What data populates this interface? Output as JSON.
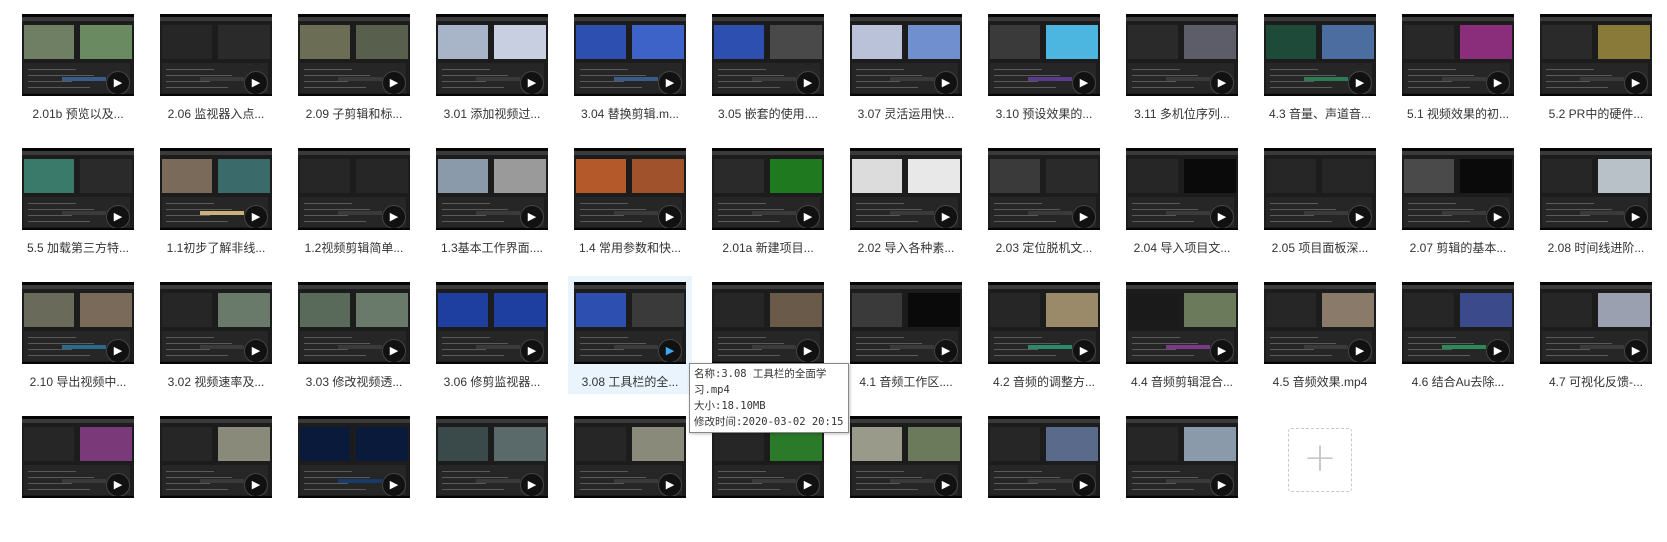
{
  "files": [
    {
      "name": "2.01b 预览以及...",
      "ps": [
        "#6e7f63",
        "#6a8b62"
      ],
      "tc": "#3a5a8a"
    },
    {
      "name": "2.06 监视器入点...",
      "ps": [
        "#262626",
        "#2a2a2a"
      ],
      "tc": "#3a3a3a"
    },
    {
      "name": "2.09 子剪辑和标...",
      "ps": [
        "#6b6d55",
        "#58604d"
      ],
      "tc": "#3a3a3a"
    },
    {
      "name": "3.01 添加视频过...",
      "ps": [
        "#a8b4c8",
        "#c7cfe0"
      ],
      "tc": "#3a3a3a"
    },
    {
      "name": "3.04 替换剪辑.m...",
      "ps": [
        "#2d4fb0",
        "#3d63c9"
      ],
      "tc": "#3a5a8a"
    },
    {
      "name": "3.05 嵌套的使用....",
      "ps": [
        "#2d4fb0",
        "#494949"
      ],
      "tc": "#3a3a3a"
    },
    {
      "name": "3.07 灵活运用快...",
      "ps": [
        "#b9c2d8",
        "#6f8fcf"
      ],
      "tc": "#3a3a3a"
    },
    {
      "name": "3.10 预设效果的...",
      "ps": [
        "#3a3a3a",
        "#4cb6e0"
      ],
      "tc": "#5a3a8a"
    },
    {
      "name": "3.11 多机位序列...",
      "ps": [
        "#2a2a2a",
        "#5d5d6a"
      ],
      "tc": "#3a3a3a"
    },
    {
      "name": "4.3 音量、声道音...",
      "ps": [
        "#1e4a3a",
        "#4c6da0"
      ],
      "tc": "#2e7a55"
    },
    {
      "name": "5.1 视频效果的初...",
      "ps": [
        "#282828",
        "#8a2d7a"
      ],
      "tc": "#3a3a3a"
    },
    {
      "name": "5.2 PR中的硬件...",
      "ps": [
        "#2a2a2a",
        "#8a7a3a"
      ],
      "tc": "#3a3a3a"
    },
    {
      "name": "5.5 加载第三方特...",
      "ps": [
        "#3a7a6a",
        "#2a2a2a"
      ],
      "tc": "#3a3a3a"
    },
    {
      "name": "1.1初步了解非线...",
      "ps": [
        "#7a6a5a",
        "#3a6a6a"
      ],
      "tc": "#c9b37a"
    },
    {
      "name": "1.2视频剪辑简单...",
      "ps": [
        "#262626",
        "#262626"
      ],
      "tc": "#3a3a3a"
    },
    {
      "name": "1.3基本工作界面....",
      "ps": [
        "#8a9aaa",
        "#9a9a9a"
      ],
      "tc": "#3a3a3a"
    },
    {
      "name": "1.4 常用参数和快...",
      "ps": [
        "#b45a2a",
        "#a0522d"
      ],
      "tc": "#3a3a3a"
    },
    {
      "name": "2.01a 新建项目...",
      "ps": [
        "#2a2a2a",
        "#1f7a1f"
      ],
      "tc": "#3a3a3a"
    },
    {
      "name": "2.02 导入各种素...",
      "ps": [
        "#dcdcdc",
        "#e8e8e8"
      ],
      "tc": "#3a3a3a"
    },
    {
      "name": "2.03 定位脱机文...",
      "ps": [
        "#3a3a3a",
        "#2a2a2a"
      ],
      "tc": "#3a3a3a"
    },
    {
      "name": "2.04 导入项目文...",
      "ps": [
        "#262626",
        "#0a0a0a"
      ],
      "tc": "#3a3a3a"
    },
    {
      "name": "2.05 项目面板深...",
      "ps": [
        "#262626",
        "#262626"
      ],
      "tc": "#3a3a3a"
    },
    {
      "name": "2.07 剪辑的基本...",
      "ps": [
        "#4a4a4a",
        "#0a0a0a"
      ],
      "tc": "#3a3a3a"
    },
    {
      "name": "2.08 时间线进阶...",
      "ps": [
        "#262626",
        "#b8c0c8"
      ],
      "tc": "#3a3a3a"
    },
    {
      "name": "2.10 导出视频中...",
      "ps": [
        "#6a6a5a",
        "#7a6a5a"
      ],
      "tc": "#2a6a8a"
    },
    {
      "name": "3.02 视频速率及...",
      "ps": [
        "#262626",
        "#6a7a6a"
      ],
      "tc": "#3a3a3a"
    },
    {
      "name": "3.03 修改视频透...",
      "ps": [
        "#5a6a5a",
        "#6a7a6a"
      ],
      "tc": "#3a3a3a"
    },
    {
      "name": "3.06 修剪监视器...",
      "ps": [
        "#1f3fa0",
        "#1f3fa0"
      ],
      "tc": "#3a3a3a"
    },
    {
      "name": "3.08 工具栏的全...",
      "ps": [
        "#2d4fb0",
        "#3a3a3a"
      ],
      "tc": "#3a3a3a"
    },
    {
      "name": "",
      "ps": [
        "#262626",
        "#6a5a4a"
      ],
      "tc": "#3a3a3a"
    },
    {
      "name": "4.1 音频工作区....",
      "ps": [
        "#3a3a3a",
        "#0a0a0a"
      ],
      "tc": "#3a3a3a"
    },
    {
      "name": "4.2 音频的调整方...",
      "ps": [
        "#262626",
        "#9a8a6a"
      ],
      "tc": "#2a8a6a"
    },
    {
      "name": "4.4 音频剪辑混合...",
      "ps": [
        "#1a1a1a",
        "#6a7a5a"
      ],
      "tc": "#7a3a8a"
    },
    {
      "name": "4.5 音频效果.mp4",
      "ps": [
        "#262626",
        "#8a7a6a"
      ],
      "tc": "#3a3a3a"
    },
    {
      "name": "4.6 结合Au去除...",
      "ps": [
        "#262626",
        "#3a4a8a"
      ],
      "tc": "#2a8a5a"
    },
    {
      "name": "4.7 可视化反馈-...",
      "ps": [
        "#262626",
        "#9aa0b0"
      ],
      "tc": "#3a3a3a"
    },
    {
      "name": "",
      "ps": [
        "#262626",
        "#7a3a7a"
      ],
      "tc": "#3a3a3a"
    },
    {
      "name": "",
      "ps": [
        "#262626",
        "#8a8a7a"
      ],
      "tc": "#3a3a3a"
    },
    {
      "name": "",
      "ps": [
        "#0a1a3a",
        "#0a1a3a"
      ],
      "tc": "#1a3a6a"
    },
    {
      "name": "",
      "ps": [
        "#3a4a4a",
        "#5a6a6a"
      ],
      "tc": "#3a3a3a"
    },
    {
      "name": "",
      "ps": [
        "#262626",
        "#8a8a7a"
      ],
      "tc": "#3a3a3a"
    },
    {
      "name": "",
      "ps": [
        "#262626",
        "#2a7a2a"
      ],
      "tc": "#3a3a3a"
    },
    {
      "name": "",
      "ps": [
        "#9a9a8a",
        "#6a7a5a"
      ],
      "tc": "#3a3a3a"
    },
    {
      "name": "",
      "ps": [
        "#262626",
        "#5a6a8a"
      ],
      "tc": "#3a3a3a"
    },
    {
      "name": "",
      "ps": [
        "#262626",
        "#8a9aaa"
      ],
      "tc": "#3a3a3a"
    }
  ],
  "selected_index": 28,
  "add_button": {
    "label": "+"
  },
  "play_glyph": "▶",
  "tooltip": {
    "name_line1": "名称:3.08 工具栏的全面学",
    "name_line2": "习.mp4",
    "size": "大小:18.10MB",
    "modified": "修改时间:2020-03-02 20:15"
  }
}
